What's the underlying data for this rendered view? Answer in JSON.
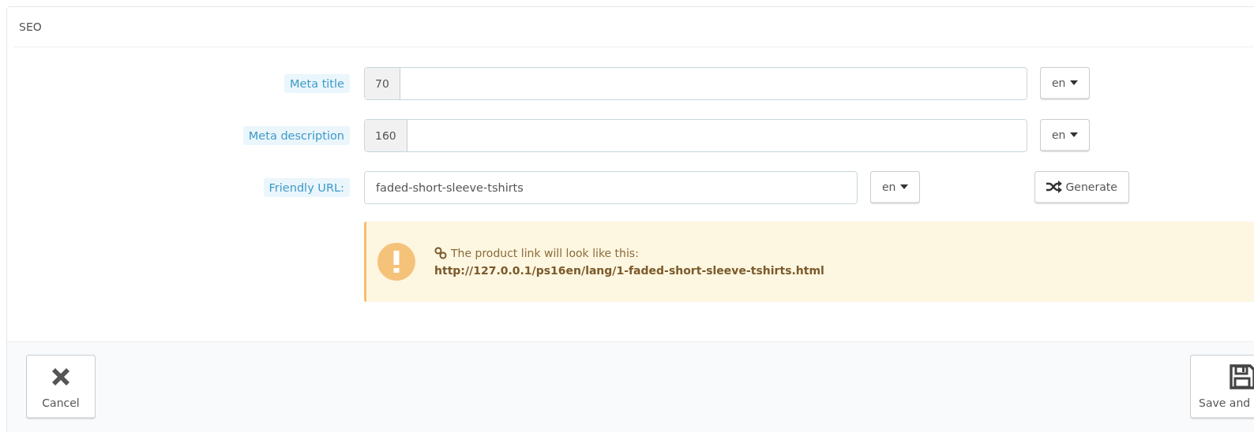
{
  "panel": {
    "title": "SEO"
  },
  "fields": [
    {
      "kind": "counted",
      "label": "Meta title",
      "counter": "70",
      "language": "en"
    },
    {
      "kind": "counted",
      "label": "Meta description",
      "counter": "160",
      "language": "en"
    },
    {
      "kind": "text",
      "label": "Friendly URL:",
      "value": "faded-short-sleeve-tshirts",
      "language": "en",
      "action": "Generate"
    }
  ],
  "notice": {
    "text": "The product link will look like this:",
    "url": "http://127.0.0.1/ps16en/lang/1-faded-short-sleeve-tshirts.html"
  },
  "footer": {
    "buttons": [
      {
        "kind": "cancel",
        "label": "Cancel"
      },
      {
        "kind": "save",
        "label": "Save and"
      }
    ]
  }
}
